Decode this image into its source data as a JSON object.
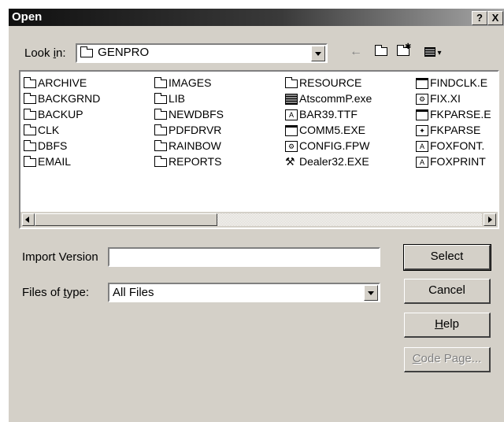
{
  "window": {
    "title": "Open",
    "help_label": "?",
    "close_label": "X"
  },
  "lookin": {
    "label_pre": "Look ",
    "label_ul": "i",
    "label_post": "n:",
    "value": "GENPRO"
  },
  "toolbar": {
    "back_icon": "back-arrow-icon",
    "up_icon": "up-folder-icon",
    "newfolder_icon": "new-folder-icon",
    "view_icon": "view-menu-icon"
  },
  "files": {
    "col1": [
      "ARCHIVE",
      "BACKGRND",
      "BACKUP",
      "CLK",
      "DBFS",
      "EMAIL"
    ],
    "col2": [
      "IMAGES",
      "LIB",
      "NEWDBFS",
      "PDFDRVR",
      "RAINBOW",
      "REPORTS"
    ],
    "col3": [
      "RESOURCE",
      "AtscommP.exe",
      "BAR39.TTF",
      "COMM5.EXE",
      "CONFIG.FPW",
      "Dealer32.EXE"
    ],
    "col4": [
      "FINDCLK.E",
      "FIX.XI",
      "FKPARSE.E",
      "FKPARSE",
      "FOXFONT.",
      "FOXPRINT"
    ]
  },
  "import": {
    "label": "Import Version",
    "value": ""
  },
  "filetype": {
    "label_pre": "Files of ",
    "label_ul": "t",
    "label_post": "ype:",
    "value": "All Files"
  },
  "buttons": {
    "select": "Select",
    "cancel": "Cancel",
    "help_ul": "H",
    "help_rest": "elp",
    "codepage_ul": "C",
    "codepage_rest": "ode Page..."
  }
}
